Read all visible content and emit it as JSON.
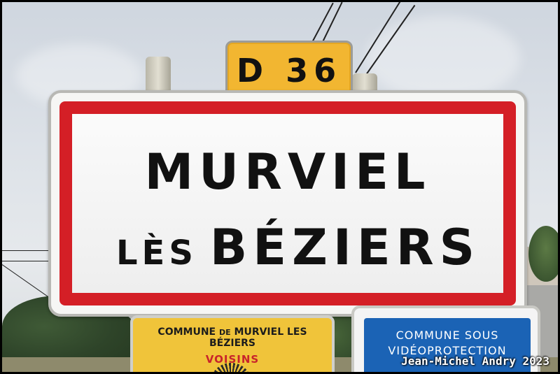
{
  "route_sign": {
    "text": "D 36",
    "color": "#f2b631"
  },
  "town_sign": {
    "line1": "MURVIEL",
    "line2_prefix": "LÈS",
    "line2_main": "BÉZIERS",
    "border_color": "#d41f26"
  },
  "commune_sign": {
    "line1_a": "COMMUNE",
    "line1_de": "DE",
    "line1_b": "MURVIEL LES BÉZIERS",
    "line2": "VOISINS",
    "color": "#f0c43a"
  },
  "video_sign": {
    "line1": "COMMUNE SOUS",
    "line2": "VIDÉOPROTECTION",
    "color": "#1b63b5"
  },
  "credit": "Jean-Michel Andry 2023"
}
